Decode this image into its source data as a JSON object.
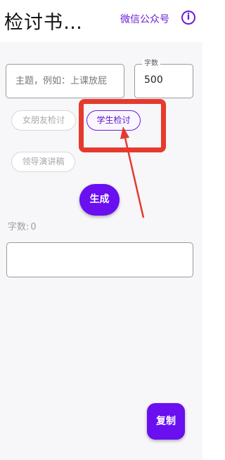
{
  "header": {
    "title": "检讨书…",
    "wechat_link": "微信公众号",
    "info_icon": "info-circle-icon",
    "info_glyph": "i"
  },
  "form": {
    "topic_placeholder": "主题，例如：上课放屁",
    "count_label": "字数",
    "count_value": "500"
  },
  "chips": [
    {
      "label": "女朋友检讨",
      "selected": false
    },
    {
      "label": "学生检讨",
      "selected": true
    },
    {
      "label": "领导演讲稿",
      "selected": false
    }
  ],
  "generate_label": "生成",
  "char_count": {
    "label": "字数:",
    "value": "0"
  },
  "output_text": "",
  "copy_label": "复制",
  "colors": {
    "accent": "#6a0ff0",
    "annotation": "#e53a2e",
    "link": "#6a1fd6"
  }
}
